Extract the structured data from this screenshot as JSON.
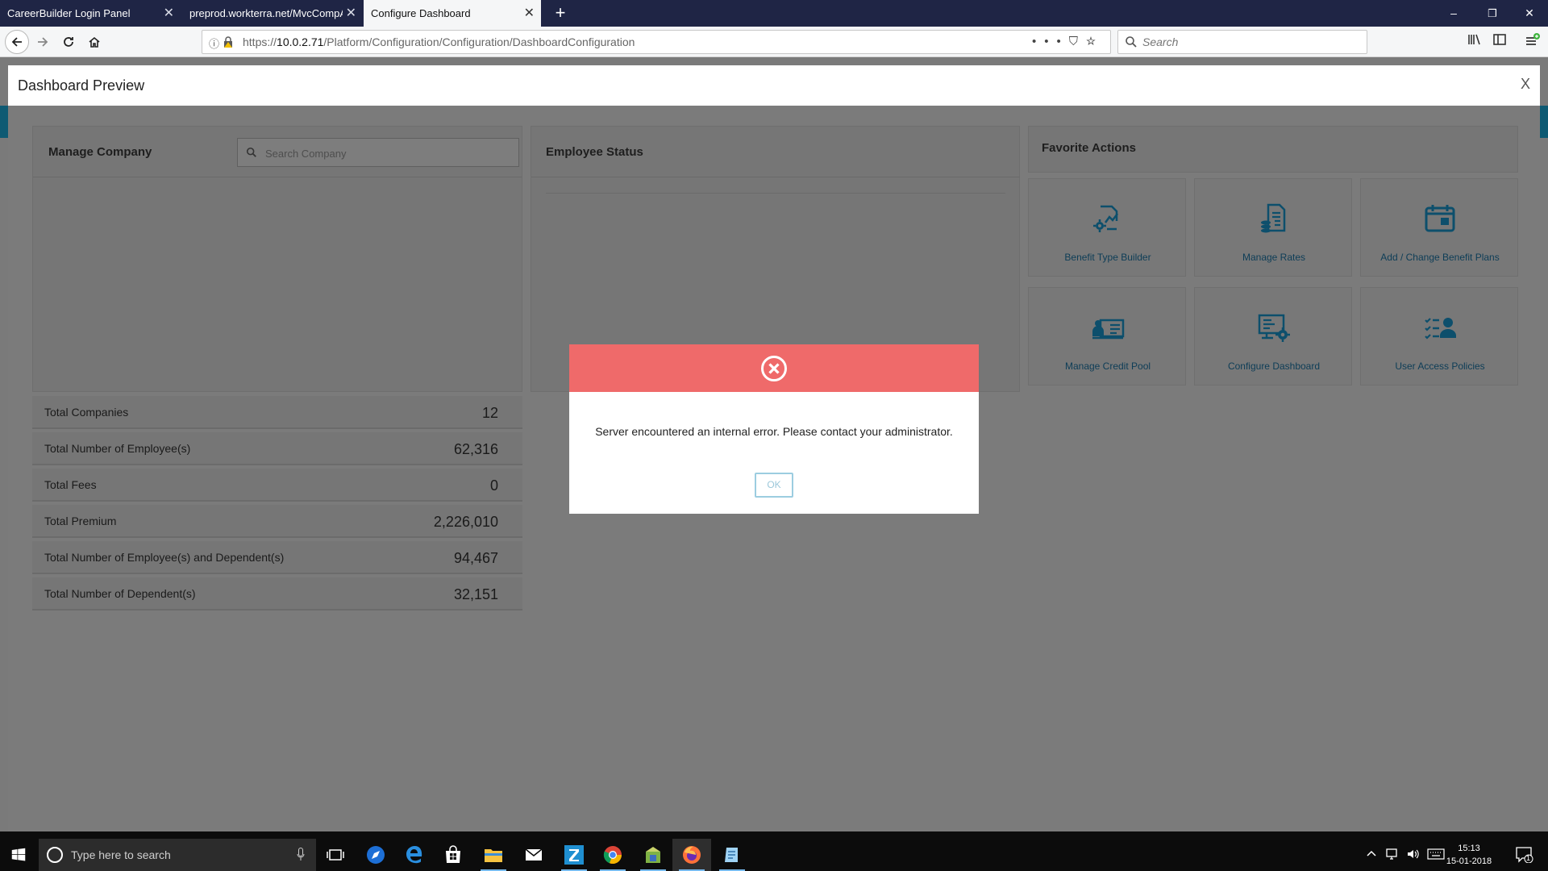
{
  "browser": {
    "tabs": [
      {
        "label": "CareerBuilder Login Panel",
        "active": false
      },
      {
        "label": "preprod.workterra.net/MvcCompAdmin",
        "active": false
      },
      {
        "label": "Configure Dashboard",
        "active": true
      }
    ],
    "url_prefix": "https://",
    "url_host": "10.0.2.71",
    "url_path": "/Platform/Configuration/Configuration/DashboardConfiguration",
    "search_placeholder": "Search",
    "new_tab": "+",
    "window_controls": {
      "minimize": "–",
      "restore": "❐",
      "close": "✕"
    },
    "page_actions": "•••"
  },
  "preview": {
    "title": "Dashboard Preview",
    "close": "X"
  },
  "manage_company": {
    "title": "Manage Company",
    "search_placeholder": "Search Company"
  },
  "employee_status": {
    "title": "Employee Status"
  },
  "favorite_actions": {
    "title": "Favorite Actions",
    "items": [
      {
        "label": "Benefit Type Builder",
        "icon": "benefit-type-builder-icon"
      },
      {
        "label": "Manage Rates",
        "icon": "manage-rates-icon"
      },
      {
        "label": "Add / Change Benefit Plans",
        "icon": "calendar-icon"
      },
      {
        "label": "Manage Credit Pool",
        "icon": "credit-pool-icon"
      },
      {
        "label": "Configure Dashboard",
        "icon": "configure-dashboard-icon"
      },
      {
        "label": "User Access Policies",
        "icon": "user-access-icon"
      }
    ]
  },
  "stats": [
    {
      "label": "Total Companies",
      "value": "12"
    },
    {
      "label": "Total Number of Employee(s)",
      "value": "62,316"
    },
    {
      "label": "Total Fees",
      "value": "0"
    },
    {
      "label": "Total Premium",
      "value": "2,226,010"
    },
    {
      "label": "Total Number of Employee(s) and Dependent(s)",
      "value": "94,467"
    },
    {
      "label": "Total Number of Dependent(s)",
      "value": "32,151"
    }
  ],
  "modal": {
    "message": "Server encountered an internal error. Please contact your administrator.",
    "ok_label": "OK",
    "header_color": "#ef6a6a"
  },
  "taskbar": {
    "search_placeholder": "Type here to search",
    "time": "15:13",
    "date": "15-01-2018",
    "notification_count": "1"
  },
  "colors": {
    "accent": "#0d5a76",
    "overlay": "#7a7a7a",
    "error": "#ef6a6a"
  }
}
